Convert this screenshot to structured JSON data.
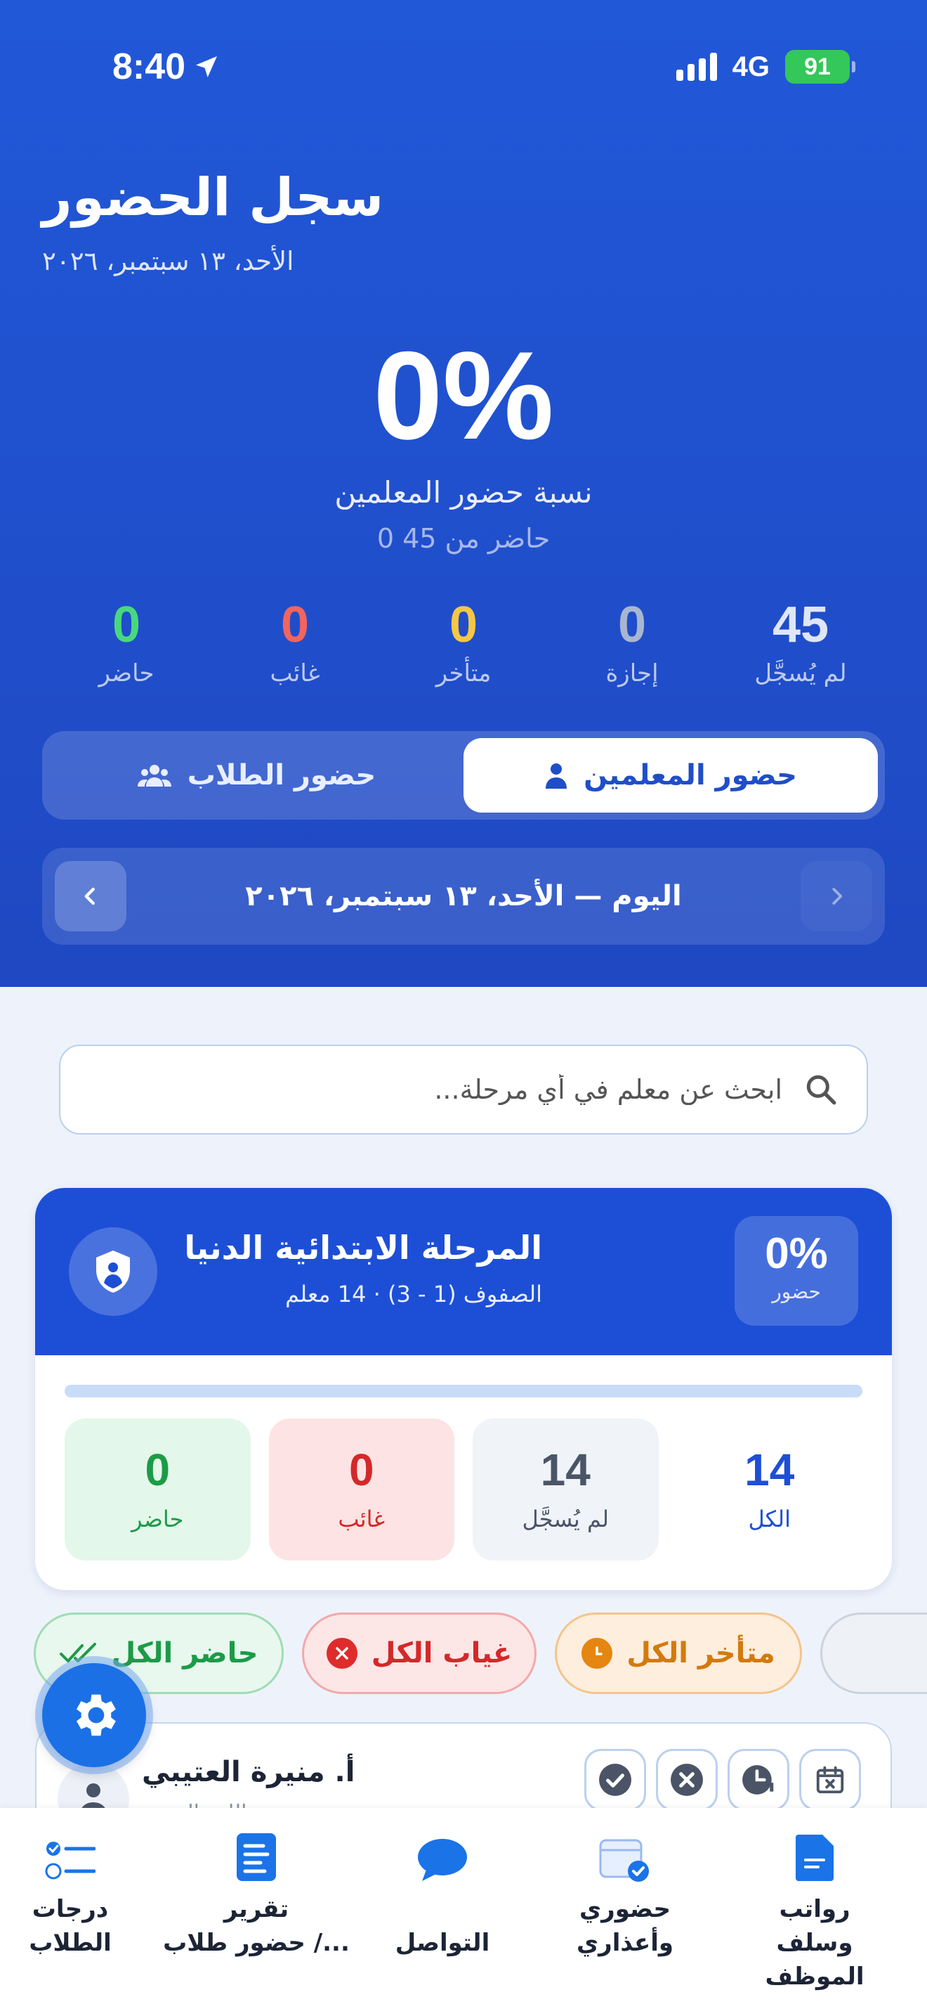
{
  "status_bar": {
    "time": "8:40",
    "network": "4G",
    "battery": "91"
  },
  "header": {
    "title": "سجل الحضور",
    "date": "الأحد، ١٣ سبتمبر، ٢٠٢٦"
  },
  "summary": {
    "percent": "0%",
    "label": "نسبة حضور المعلمين",
    "subtitle": "0 حاضر من 45"
  },
  "stats": [
    {
      "value": "45",
      "label": "لم يُسجَّل",
      "color": "#dfe6f5"
    },
    {
      "value": "0",
      "label": "إجازة",
      "color": "#a9b6cf"
    },
    {
      "value": "0",
      "label": "متأخر",
      "color": "#f6c744"
    },
    {
      "value": "0",
      "label": "غائب",
      "color": "#f2645e"
    },
    {
      "value": "0",
      "label": "حاضر",
      "color": "#48d97c"
    }
  ],
  "segments": {
    "teachers": "حضور المعلمين",
    "students": "حضور الطلاب"
  },
  "day_nav": {
    "label": "اليوم — الأحد، ١٣ سبتمبر، ٢٠٢٦"
  },
  "search": {
    "placeholder": "ابحث عن معلم في أي مرحلة..."
  },
  "stage_card": {
    "title": "المرحلة الابتدائية الدنيا",
    "subtitle": "الصفوف (1 - 3) · 14 معلم",
    "percent": "0%",
    "percent_label": "حضور",
    "progress": 0,
    "cells": [
      {
        "value": "14",
        "label": "الكل"
      },
      {
        "value": "14",
        "label": "لم يُسجَّل"
      },
      {
        "value": "0",
        "label": "غائب"
      },
      {
        "value": "0",
        "label": "حاضر"
      }
    ]
  },
  "actions": {
    "present_all": "حاضر الكل",
    "absent_all": "غياب الكل",
    "late_all": "متأخر الكل"
  },
  "teacher": {
    "name": "أ. منيرة العتيبي",
    "subject": "اللغة العربية"
  },
  "tabbar": [
    {
      "label": "رواتب\nوسلف الموظف",
      "icon": "document-icon"
    },
    {
      "label": "حضوري\nوأعذاري",
      "icon": "calendar-check-icon"
    },
    {
      "label": "التواصل",
      "icon": "chat-bubble-icon"
    },
    {
      "label": "تقرير\nحضور طلاب /...",
      "icon": "report-icon"
    },
    {
      "label": "درجات\nالطلاب",
      "icon": "checklist-icon"
    }
  ],
  "colors": {
    "primary": "#1d4fd6",
    "hero_bg": "#2158d8",
    "fab": "#1b70e6"
  }
}
